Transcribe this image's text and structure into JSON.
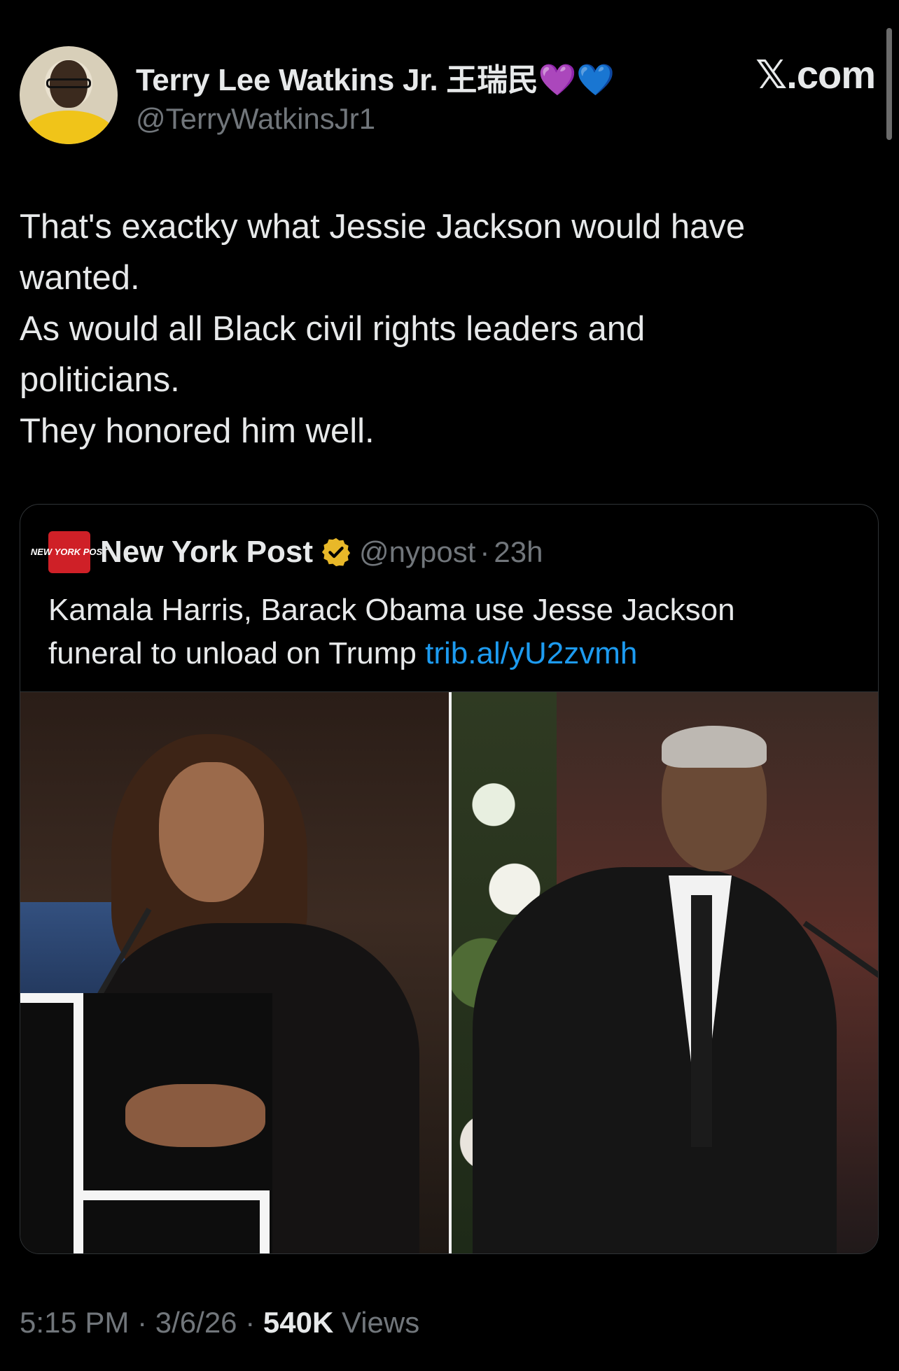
{
  "author": {
    "display_name": "Terry Lee Watkins Jr. 王瑞民",
    "emoji": "💜💙",
    "handle": "@TerryWatkinsJr1"
  },
  "brand": "𝕏.com",
  "tweet": {
    "lines": [
      "That's exactky what Jessie Jackson would have",
      "wanted.",
      "As would all Black civil rights leaders and",
      "politicians.",
      "They honored him well."
    ]
  },
  "quote": {
    "logo_text": "NEW YORK POST",
    "name": "New York Post",
    "handle": "@nypost",
    "separator": "·",
    "time": "23h",
    "text_line1": "Kamala Harris, Barack Obama use Jesse Jackson",
    "text_line2_prefix": "funeral to unload on Trump ",
    "link": "trib.al/yU2zvmh",
    "verified_color": "#e8b829"
  },
  "footer": {
    "time": "5:15 PM",
    "date": "3/6/26",
    "separator": "·",
    "views_count": "540K",
    "views_label": "Views"
  },
  "colors": {
    "background": "#000000",
    "text": "#e7e9ea",
    "muted": "#71767b",
    "link": "#1d9bf0",
    "border": "#2f3336"
  }
}
